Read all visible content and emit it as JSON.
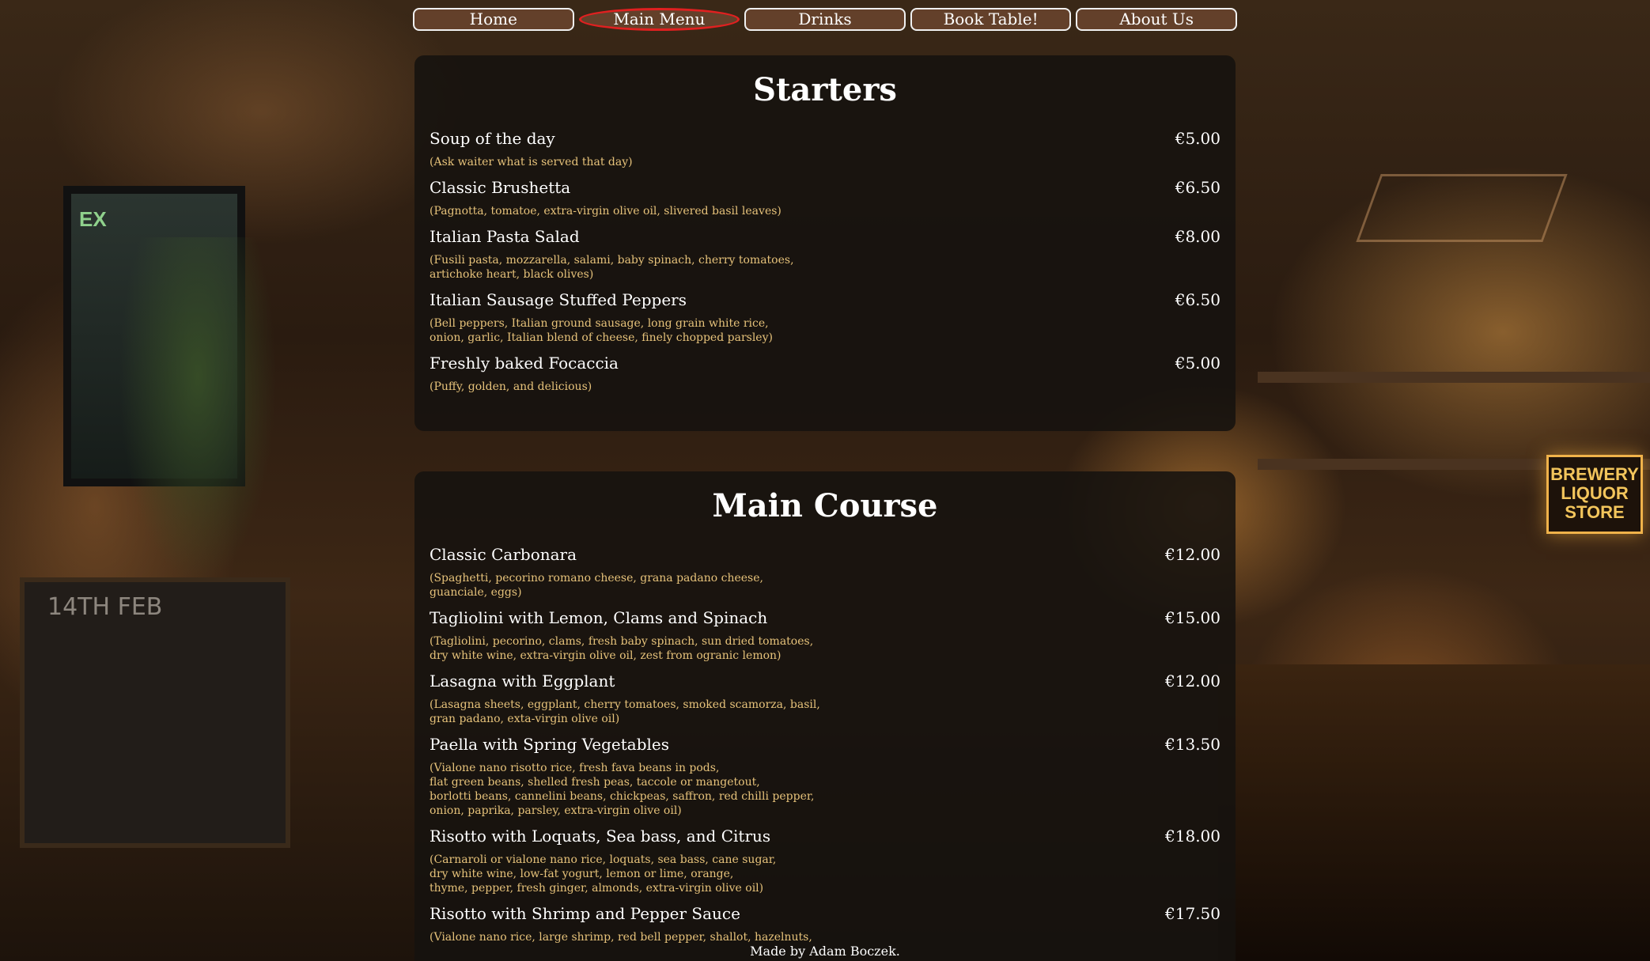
{
  "nav": {
    "items": [
      {
        "label": "Home"
      },
      {
        "label": "Main Menu"
      },
      {
        "label": "Drinks"
      },
      {
        "label": "Book Table!"
      },
      {
        "label": "About Us"
      }
    ]
  },
  "background": {
    "sign_text": "BREWERY LIQUOR STORE",
    "chalk_text": "14TH FEB",
    "exit_text": "EX"
  },
  "starters": {
    "title": "Starters",
    "items": [
      {
        "name": "Soup of the day",
        "price": "€5.00",
        "desc": "(Ask waiter what is served that day)"
      },
      {
        "name": "Classic Brushetta",
        "price": "€6.50",
        "desc": "(Pagnotta, tomatoe, extra-virgin olive oil, slivered basil leaves)"
      },
      {
        "name": "Italian Pasta Salad",
        "price": "€8.00",
        "desc": "(Fusili pasta, mozzarella, salami, baby spinach, cherry tomatoes,\nartichoke heart, black olives)"
      },
      {
        "name": "Italian Sausage Stuffed Peppers",
        "price": "€6.50",
        "desc": "(Bell peppers, Italian ground sausage, long grain white rice,\nonion, garlic, Italian blend of cheese, finely chopped parsley)"
      },
      {
        "name": "Freshly baked Focaccia",
        "price": "€5.00",
        "desc": "(Puffy, golden, and delicious)"
      }
    ]
  },
  "main_course": {
    "title": "Main Course",
    "items": [
      {
        "name": "Classic Carbonara",
        "price": "€12.00",
        "desc": "(Spaghetti, pecorino romano cheese, grana padano cheese,\nguanciale, eggs)"
      },
      {
        "name": "Tagliolini with Lemon, Clams and Spinach",
        "price": "€15.00",
        "desc": "(Tagliolini, pecorino, clams, fresh baby spinach, sun dried tomatoes,\ndry white wine, extra-virgin olive oil, zest from ogranic lemon)"
      },
      {
        "name": "Lasagna with Eggplant",
        "price": "€12.00",
        "desc": "(Lasagna sheets, eggplant, cherry tomatoes, smoked scamorza, basil,\ngran padano, exta-virgin olive oil)"
      },
      {
        "name": "Paella with Spring Vegetables",
        "price": "€13.50",
        "desc": "(Vialone nano risotto rice, fresh fava beans in pods,\nflat green beans, shelled fresh peas, taccole or mangetout,\nborlotti beans, cannelini beans, chickpeas, saffron, red chilli pepper,\nonion, paprika, parsley, extra-virgin olive oil)"
      },
      {
        "name": "Risotto with Loquats, Sea bass, and Citrus",
        "price": "€18.00",
        "desc": "(Carnaroli or vialone nano rice, loquats, sea bass, cane sugar,\ndry white wine, low-fat yogurt, lemon or lime, orange,\nthyme, pepper, fresh ginger, almonds, extra-virgin olive oil)"
      },
      {
        "name": "Risotto with Shrimp and Pepper Sauce",
        "price": "€17.50",
        "desc": "(Vialone nano rice, large shrimp, red bell pepper, shallot, hazelnuts,"
      }
    ]
  },
  "footer": {
    "text": "Made by Adam Boczek."
  },
  "colors": {
    "accent_border": "#e02020",
    "desc_text": "#e6c27a",
    "nav_bg": "#63402a"
  }
}
